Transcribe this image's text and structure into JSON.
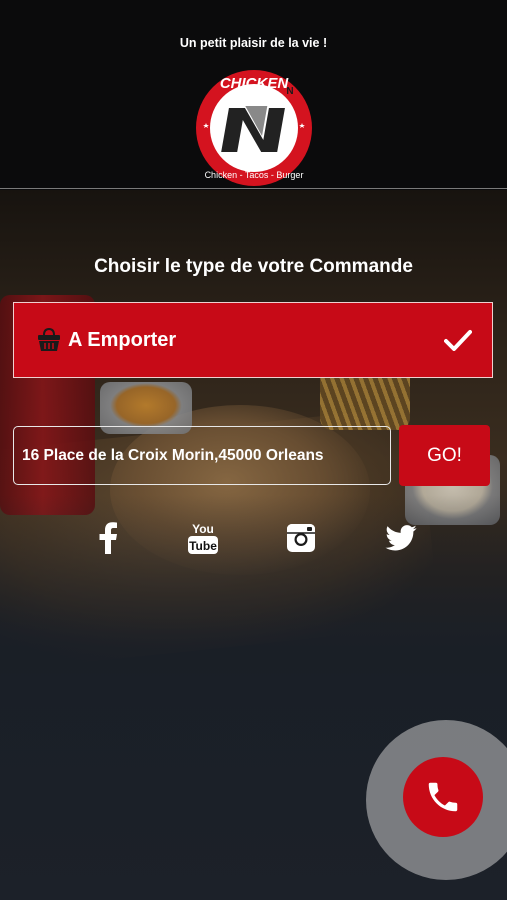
{
  "header": {
    "tagline": "Un petit plaisir de la vie !",
    "logo": {
      "brand_text": "CHICKEN",
      "letter": "N",
      "sub_letter": "N",
      "subtitle": "Chicken - Tacos - Burger"
    }
  },
  "main": {
    "title": "Choisir le type de votre Commande",
    "order_type": {
      "label": "A Emporter",
      "icon": "basket-icon",
      "selected_icon": "check-icon",
      "selected": true
    },
    "address": {
      "value": "16 Place de la Croix Morin,45000 Orleans"
    },
    "go_label": "GO!"
  },
  "social": [
    {
      "name": "facebook",
      "icon": "facebook-icon"
    },
    {
      "name": "youtube",
      "icon": "youtube-icon",
      "text_top": "You",
      "text_bottom": "Tube"
    },
    {
      "name": "instagram",
      "icon": "instagram-icon"
    },
    {
      "name": "twitter",
      "icon": "twitter-icon"
    }
  ],
  "call": {
    "icon": "phone-icon"
  },
  "colors": {
    "accent": "#c70a17",
    "background": "#0b0b0c",
    "text": "#ffffff"
  }
}
